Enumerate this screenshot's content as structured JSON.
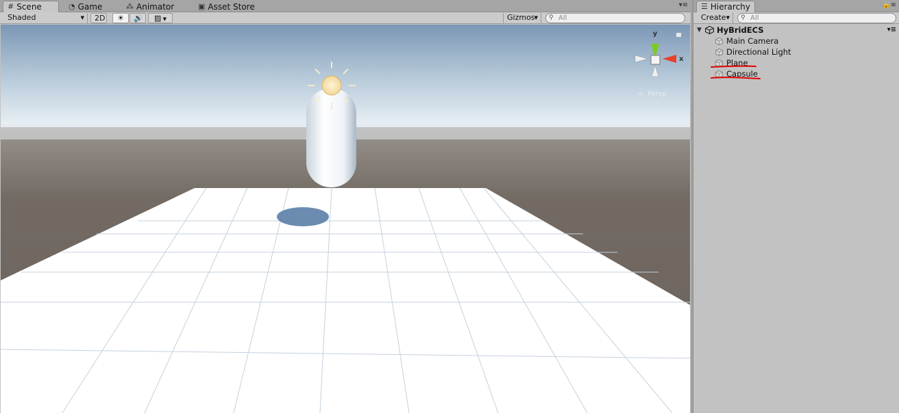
{
  "scene_panel": {
    "tabs": [
      {
        "label": "Scene",
        "icon": "grid-icon"
      },
      {
        "label": "Game",
        "icon": "pacman-icon"
      },
      {
        "label": "Animator",
        "icon": "animator-icon"
      },
      {
        "label": "Asset Store",
        "icon": "store-icon"
      }
    ],
    "toolbar": {
      "draw_mode": "Shaded",
      "mode_2d": "2D",
      "gizmos": "Gizmos",
      "search_placeholder": "All"
    },
    "gizmo": {
      "y_label": "y",
      "x_label": "x",
      "projection": "Persp"
    }
  },
  "hierarchy_panel": {
    "tab_label": "Hierarchy",
    "create_label": "Create",
    "search_placeholder": "All",
    "scene_name": "HyBridECS",
    "objects": [
      "Main Camera",
      "Directional Light",
      "Plane",
      "Capsule"
    ]
  },
  "colors": {
    "sky_top": "#7e9ab8",
    "horizon": "#e6eef3",
    "ground": "#6d655e",
    "plane": "#ffffff",
    "annotation": "#e00000",
    "axis_x": "#e8402a",
    "axis_y": "#7ccb26"
  }
}
